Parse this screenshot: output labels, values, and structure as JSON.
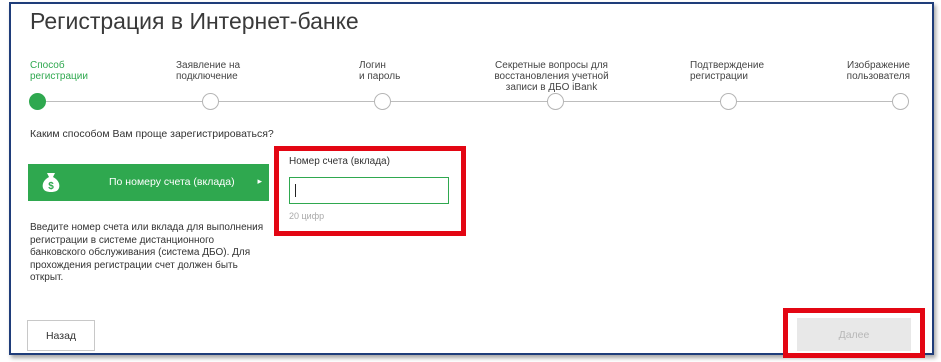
{
  "page": {
    "title": "Регистрация в Интернет-банке",
    "question": "Каким способом Вам проще зарегистрироваться?"
  },
  "steps": [
    {
      "line1": "Способ",
      "line2": "регистрации",
      "line3": "",
      "state": "active"
    },
    {
      "line1": "Заявление на",
      "line2": "подключение",
      "line3": "",
      "state": "pending"
    },
    {
      "line1": "Логин",
      "line2": "и пароль",
      "line3": "",
      "state": "pending"
    },
    {
      "line1": "Секретные вопросы для",
      "line2": "восстановления учетной",
      "line3": "записи в ДБО iBank",
      "state": "pending"
    },
    {
      "line1": "Подтверждение",
      "line2": "регистрации",
      "line3": "",
      "state": "pending"
    },
    {
      "line1": "Изображение",
      "line2": "пользователя",
      "line3": "",
      "state": "pending"
    }
  ],
  "method": {
    "label": "По номеру счета (вклада)",
    "icon": "money-bag-icon",
    "arrow": "▸"
  },
  "info_text": "Введите номер счета или вклада для выполнения регистрации в системе дистанционного банковского обслуживания (система ДБО). Для прохождения регистрации счет должен быть открыт.",
  "account_field": {
    "label": "Номер счета (вклада)",
    "value": "",
    "hint": "20 цифр"
  },
  "buttons": {
    "back": "Назад",
    "next": "Далее"
  },
  "colors": {
    "accent": "#2fa84f",
    "highlight": "#e30613",
    "frame": "#1f3d7a"
  }
}
